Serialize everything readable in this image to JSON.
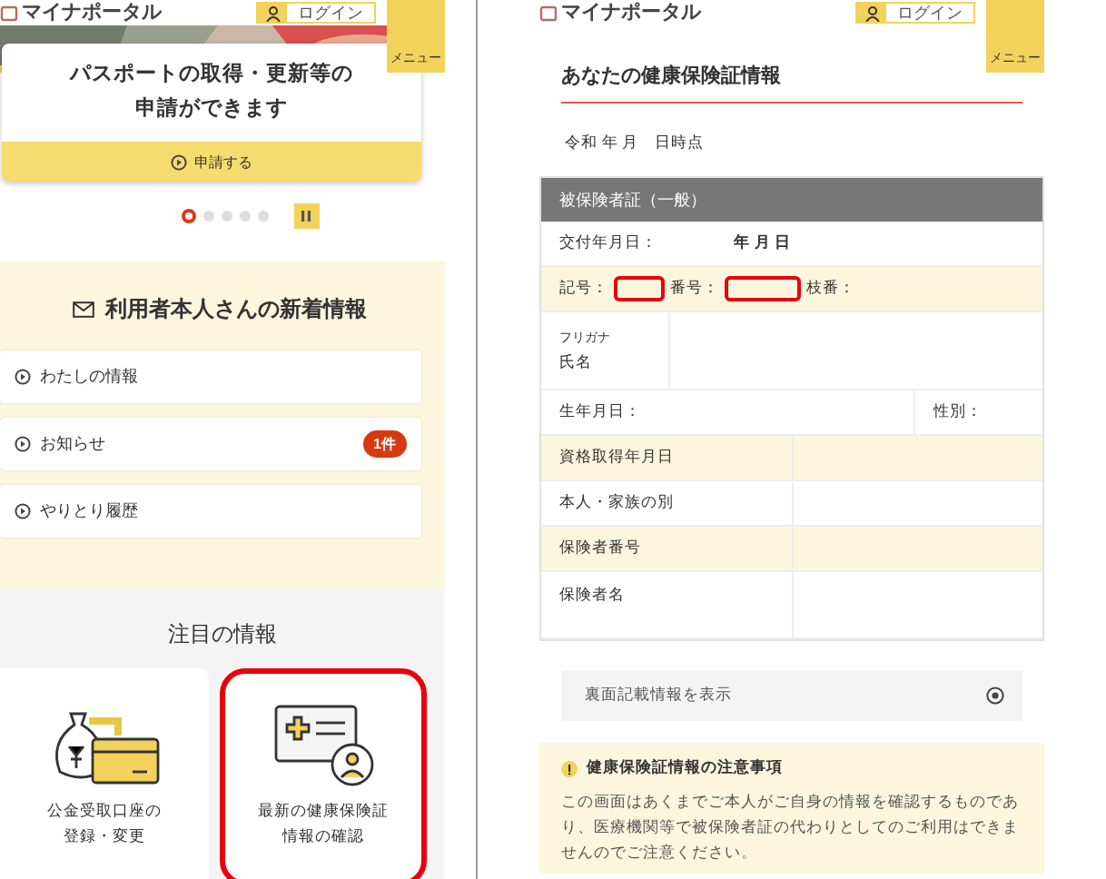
{
  "left_screen": {
    "header": {
      "logo": "マイナポータル",
      "login": "ログイン",
      "menu": "メニュー"
    },
    "banner": {
      "title": "パスポートの取得・更新等の申請ができます",
      "button": "申請する"
    },
    "carousel": {
      "dots": [
        {
          "selected": true
        },
        {
          "selected": false
        },
        {
          "selected": false
        },
        {
          "selected": false
        },
        {
          "selected": false
        }
      ]
    },
    "news": {
      "title": "利用者本人さんの新着情報",
      "items": [
        {
          "label": "わたしの情報"
        },
        {
          "label": "お知らせ",
          "badge": "1件"
        },
        {
          "label": "やりとり履歴"
        }
      ]
    },
    "featured": {
      "title": "注目の情報",
      "cards": [
        {
          "kind": "money",
          "label": "公金受取口座の登録・変更",
          "highlighted": false
        },
        {
          "kind": "insurance",
          "label": "最新の健康保険証情報の確認",
          "highlighted": true
        }
      ]
    }
  },
  "right_screen": {
    "header": {
      "logo": "マイナポータル",
      "login": "ログイン",
      "menu": "メニュー"
    },
    "title": "あなたの健康保険証情報",
    "as_of": "令和 年 月　日時点",
    "card": {
      "heading": "被保険者証（一般）",
      "issue_date_label": "交付年月日：",
      "issue_date_value": "年 月 日",
      "symbol_label": "記号：",
      "symbol_highlighted": true,
      "number_label": "番号：",
      "number_highlighted": true,
      "branch_label": "枝番：",
      "furigana_label": "フリガナ",
      "name_label": "氏名",
      "birth_label": "生年月日：",
      "sex_label": "性別：",
      "rows": [
        {
          "label": "資格取得年月日"
        },
        {
          "label": "本人・家族の別"
        },
        {
          "label": "保険者番号"
        },
        {
          "label": "保険者名"
        }
      ]
    },
    "back_info_button": "裏面記載情報を表示",
    "notice": {
      "title": "健康保険証情報の注意事項",
      "text": "この画面はあくまでご本人がご自身の情報を確認するものであり、医療機関等で被保険者証の代わりとしてのご利用はできませんのでご注意ください。"
    }
  }
}
